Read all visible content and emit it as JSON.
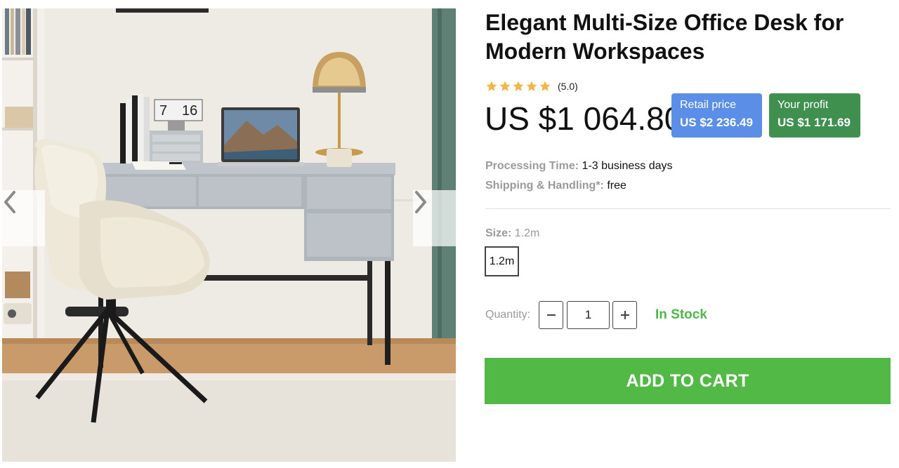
{
  "product": {
    "title": "Elegant Multi-Size Office Desk for Modern Workspaces",
    "image_alt": "Office desk with chair, lamp and laptop",
    "clock_display": [
      "7",
      "16"
    ]
  },
  "rating": {
    "stars": 5,
    "value_text": "(5.0)",
    "star_color": "#f1b644"
  },
  "price": {
    "current": "US $1 064.80"
  },
  "retail": {
    "label": "Retail price",
    "value": "US $2 236.49",
    "color": "#5b8ee6"
  },
  "profit": {
    "label": "Your profit",
    "value": "US $1 171.69",
    "color": "#3f8f4f"
  },
  "processing": {
    "label": "Processing Time:",
    "value": "1-3 business days"
  },
  "shipping": {
    "label": "Shipping & Handling*:",
    "value": "free"
  },
  "size": {
    "label": "Size:",
    "selected": "1.2m",
    "options": [
      "1.2m"
    ]
  },
  "quantity": {
    "label": "Quantity:",
    "value": "1",
    "minus_icon": "minus-icon",
    "plus_icon": "plus-icon"
  },
  "stock": {
    "text": "In Stock",
    "color": "#4cb848"
  },
  "cart": {
    "button_label": "ADD TO CART",
    "color": "#52b947"
  },
  "gallery": {
    "prev_icon": "chevron-left-icon",
    "next_icon": "chevron-right-icon"
  }
}
